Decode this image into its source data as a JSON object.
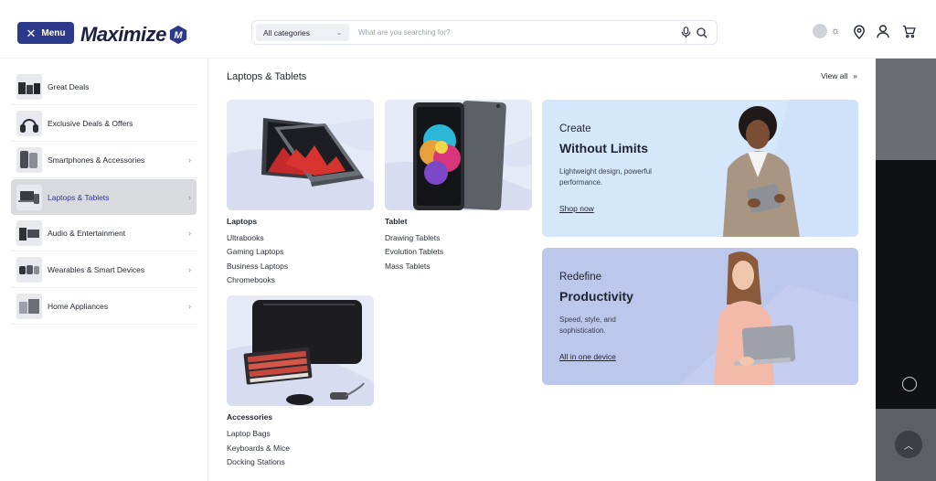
{
  "header": {
    "menu_label": "Menu",
    "logo_text": "Maximize",
    "logo_badge_letter": "M",
    "category_select": "All categories",
    "search_placeholder": "What are you searching for?"
  },
  "sidebar": {
    "items": [
      {
        "label": "Great Deals",
        "has_chevron": false
      },
      {
        "label": "Exclusive Deals & Offers",
        "has_chevron": false
      },
      {
        "label": "Smartphones & Accessories",
        "has_chevron": true
      },
      {
        "label": "Laptops & Tablets",
        "has_chevron": true,
        "active": true
      },
      {
        "label": "Audio & Entertainment",
        "has_chevron": true
      },
      {
        "label": "Wearables & Smart Devices",
        "has_chevron": true
      },
      {
        "label": "Home Appliances",
        "has_chevron": true
      }
    ]
  },
  "main": {
    "title": "Laptops & Tablets",
    "view_all": "View all",
    "categories": [
      {
        "heading": "Laptops",
        "links": [
          "Ultrabooks",
          "Gaming Laptops",
          "Business Laptops",
          "Chromebooks"
        ]
      },
      {
        "heading": "Tablet",
        "links": [
          "Drawing Tablets",
          "Evolution Tablets",
          "Mass Tablets"
        ]
      },
      {
        "heading": "Accessories",
        "links": [
          "Laptop Bags",
          "Keyboards & Mice",
          "Docking Stations"
        ]
      }
    ],
    "promos": [
      {
        "kicker": "Create",
        "title": "Without Limits",
        "desc": "Lightweight design, powerful performance.",
        "link": "Shop now"
      },
      {
        "kicker": "Redefine",
        "title": "Productivity",
        "desc": "Speed, style, and sophistication.",
        "link": "All in one device"
      }
    ]
  },
  "colors": {
    "brand_navy": "#2d3a8c",
    "active_item_bg": "#d9dadd",
    "promo_blue": "#d5e7fb",
    "promo_periwinkle": "#bcc7ec"
  },
  "icons": [
    "close-icon",
    "chevron-down-icon",
    "microphone-icon",
    "search-icon",
    "theme-toggle",
    "sun-icon",
    "location-pin-icon",
    "user-icon",
    "cart-icon",
    "chevron-right-icon",
    "double-chevron-right-icon",
    "chevron-up-icon"
  ]
}
